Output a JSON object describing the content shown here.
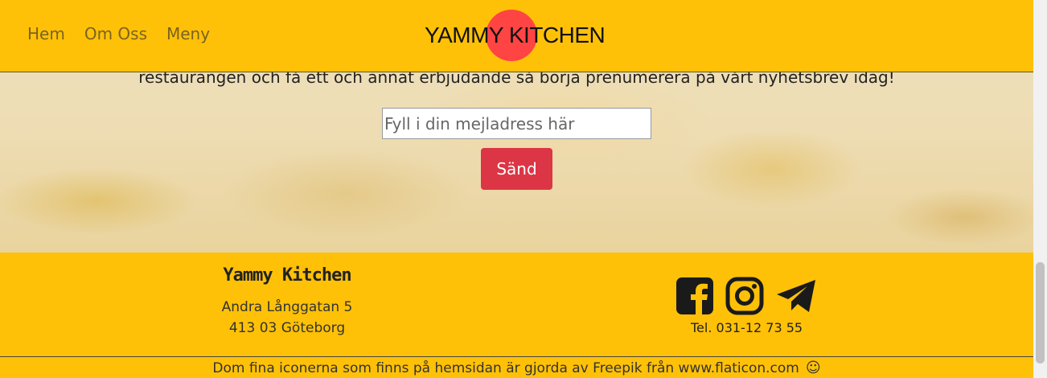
{
  "nav": {
    "links": [
      "Hem",
      "Om Oss",
      "Meny"
    ],
    "brand": "YAMMY KITCHEN"
  },
  "hero": {
    "text": "restaurangen och få ett och annat erbjudande så börja prenumerera på vårt nyhetsbrev idag!",
    "email_placeholder": "Fyll i din mejladress här",
    "send_label": "Sänd"
  },
  "footer": {
    "name": "Yammy Kitchen",
    "address_line1": "Andra Långgatan 5",
    "address_line2": "413 03 Göteborg",
    "phone": "Tel. 031-12 73 55",
    "social_icons": [
      "facebook-icon",
      "instagram-icon",
      "telegram-icon"
    ],
    "credit": "Dom fina iconerna som finns på hemsidan är gjorda av Freepik från www.flaticon.com",
    "credit_emoji": "☺"
  },
  "colors": {
    "accent": "#ffc107",
    "button": "#dc3545",
    "brand_dot": "#ff4444"
  }
}
